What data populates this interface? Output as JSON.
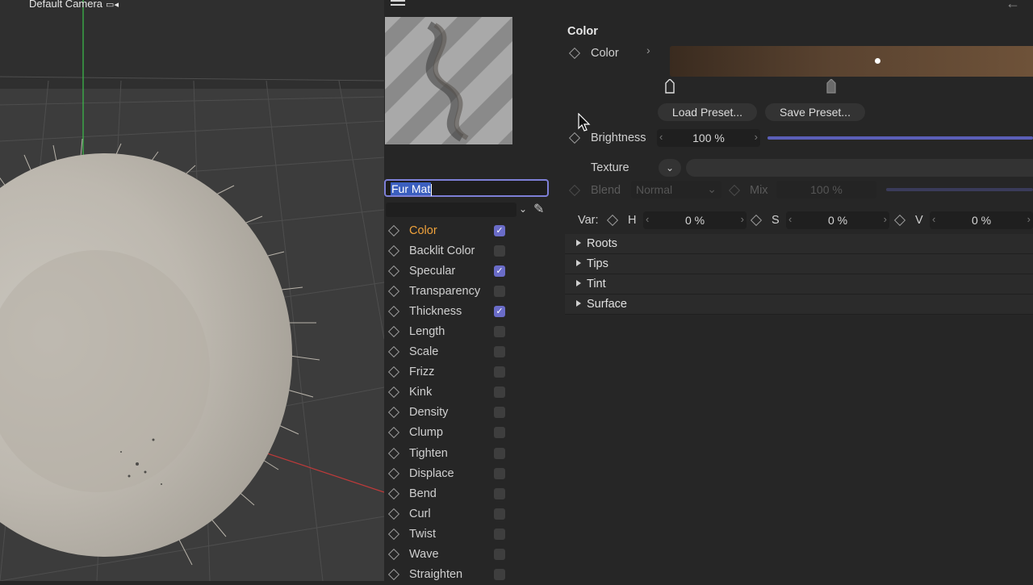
{
  "viewport": {
    "camera_label": "Default Camera"
  },
  "material": {
    "name_value": "Fur Mat",
    "channels": [
      {
        "label": "Color",
        "checked": true,
        "active": true
      },
      {
        "label": "Backlit Color",
        "checked": false
      },
      {
        "label": "Specular",
        "checked": true
      },
      {
        "label": "Transparency",
        "checked": false
      },
      {
        "label": "Thickness",
        "checked": true
      },
      {
        "label": "Length",
        "checked": false
      },
      {
        "label": "Scale",
        "checked": false
      },
      {
        "label": "Frizz",
        "checked": false
      },
      {
        "label": "Kink",
        "checked": false
      },
      {
        "label": "Density",
        "checked": false
      },
      {
        "label": "Clump",
        "checked": false
      },
      {
        "label": "Tighten",
        "checked": false
      },
      {
        "label": "Displace",
        "checked": false
      },
      {
        "label": "Bend",
        "checked": false
      },
      {
        "label": "Curl",
        "checked": false
      },
      {
        "label": "Twist",
        "checked": false
      },
      {
        "label": "Wave",
        "checked": false
      },
      {
        "label": "Straighten",
        "checked": false
      }
    ]
  },
  "color_section": {
    "title": "Color",
    "color_label": "Color",
    "load_preset": "Load Preset...",
    "save_preset": "Save Preset...",
    "brightness_label": "Brightness",
    "brightness_value": "100 %",
    "brightness_level": 1.0,
    "texture_label": "Texture",
    "blend_label": "Blend",
    "blend_value": "Normal",
    "mix_label": "Mix",
    "mix_value": "100 %",
    "var_label": "Var:",
    "h_label": "H",
    "h_value": "0 %",
    "s_label": "S",
    "s_value": "0 %",
    "v_label": "V",
    "v_value": "0 %"
  },
  "groups": [
    "Roots",
    "Tips",
    "Tint",
    "Surface"
  ],
  "colors": {
    "accent": "#6a6cc8",
    "active_channel": "#f0a23b",
    "gradient_start": "#3a2b1f",
    "gradient_end": "#6e5239"
  }
}
